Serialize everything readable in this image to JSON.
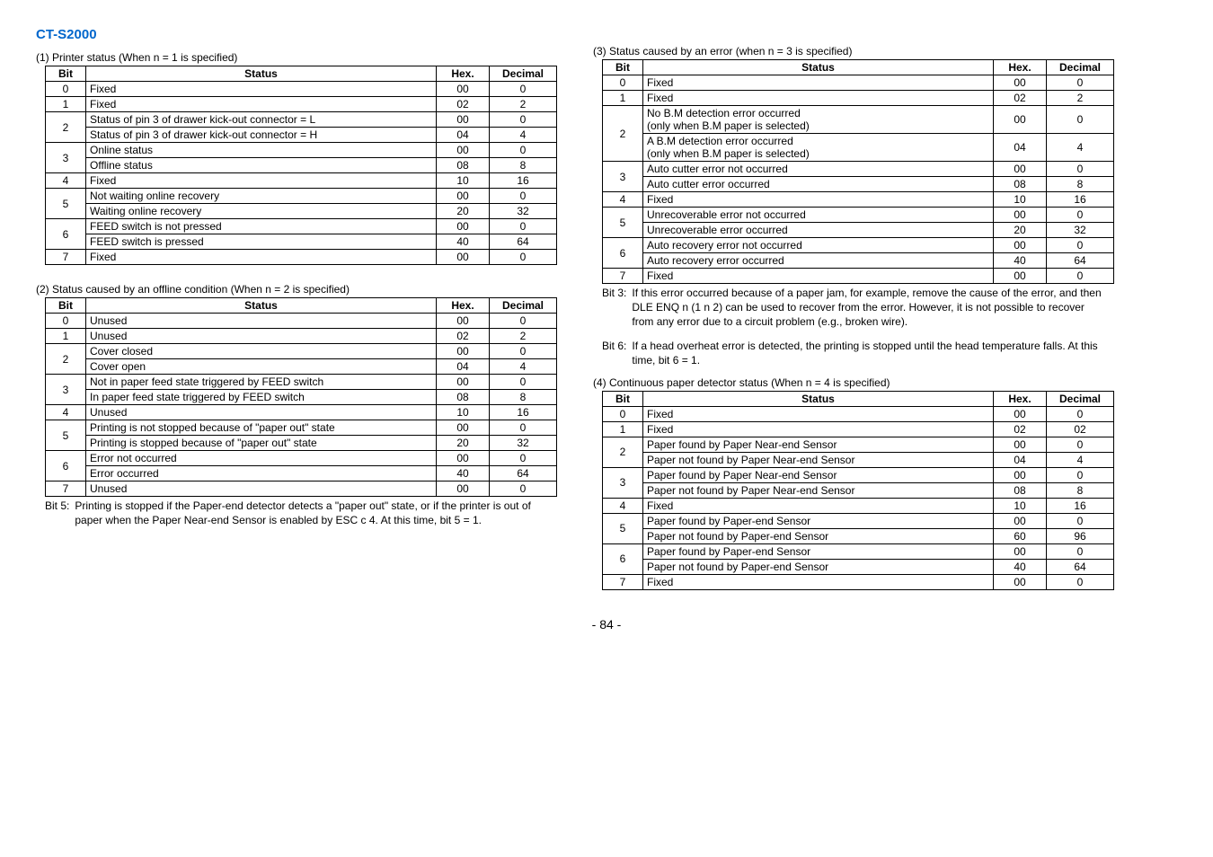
{
  "title": "CT-S2000",
  "page_number": "- 84 -",
  "left": {
    "caption1": "(1) Printer status (When n = 1 is specified)",
    "caption2": "(2) Status caused by an offline condition (When n = 2 is specified)",
    "note5_label": "Bit 5:",
    "note5_text": "Printing is stopped if the Paper-end detector detects a \"paper out\" state, or if the printer is out of paper when the Paper Near-end Sensor is enabled by ESC c 4. At this time, bit 5 = 1."
  },
  "right": {
    "caption3": "(3) Status caused by an error (when n = 3 is specified)",
    "caption4": "(4) Continuous paper detector status (When n = 4 is specified)",
    "note3_label": "Bit 3:",
    "note3_text": "If this error occurred because of a paper jam, for example, remove the cause of the error, and then DLE ENQ n (1 n 2) can be used to recover from the error. However, it is not possible to recover from any error due to a circuit problem (e.g., broken wire).",
    "note6_label": "Bit 6:",
    "note6_text": "If a head overheat error is detected, the printing is stopped until the head temperature falls. At this time, bit 6 = 1."
  },
  "headers": {
    "bit": "Bit",
    "status": "Status",
    "hex": "Hex.",
    "dec": "Decimal"
  },
  "chart_data": [
    {
      "type": "table",
      "id": "t1",
      "rows": [
        {
          "bit": "0",
          "rs": 1,
          "status": "Fixed",
          "hex": "00",
          "dec": "0"
        },
        {
          "bit": "1",
          "rs": 1,
          "status": "Fixed",
          "hex": "02",
          "dec": "2"
        },
        {
          "bit": "2",
          "rs": 2,
          "status": "Status of pin 3 of drawer kick-out connector = L",
          "hex": "00",
          "dec": "0"
        },
        {
          "status": "Status of pin 3 of drawer kick-out connector = H",
          "hex": "04",
          "dec": "4"
        },
        {
          "bit": "3",
          "rs": 2,
          "status": "Online status",
          "hex": "00",
          "dec": "0"
        },
        {
          "status": "Offline status",
          "hex": "08",
          "dec": "8"
        },
        {
          "bit": "4",
          "rs": 1,
          "status": "Fixed",
          "hex": "10",
          "dec": "16"
        },
        {
          "bit": "5",
          "rs": 2,
          "status": "Not waiting online recovery",
          "hex": "00",
          "dec": "0"
        },
        {
          "status": "Waiting online recovery",
          "hex": "20",
          "dec": "32"
        },
        {
          "bit": "6",
          "rs": 2,
          "status": "FEED switch is not pressed",
          "hex": "00",
          "dec": "0"
        },
        {
          "status": "FEED switch is pressed",
          "hex": "40",
          "dec": "64"
        },
        {
          "bit": "7",
          "rs": 1,
          "status": "Fixed",
          "hex": "00",
          "dec": "0"
        }
      ]
    },
    {
      "type": "table",
      "id": "t2",
      "rows": [
        {
          "bit": "0",
          "rs": 1,
          "status": "Unused",
          "hex": "00",
          "dec": "0"
        },
        {
          "bit": "1",
          "rs": 1,
          "status": "Unused",
          "hex": "02",
          "dec": "2"
        },
        {
          "bit": "2",
          "rs": 2,
          "status": "Cover closed",
          "hex": "00",
          "dec": "0"
        },
        {
          "status": "Cover open",
          "hex": "04",
          "dec": "4"
        },
        {
          "bit": "3",
          "rs": 2,
          "status": "Not in paper feed state triggered by FEED switch",
          "justify": true,
          "hex": "00",
          "dec": "0"
        },
        {
          "status": "In paper feed state triggered by FEED switch",
          "hex": "08",
          "dec": "8"
        },
        {
          "bit": "4",
          "rs": 1,
          "status": "Unused",
          "hex": "10",
          "dec": "16"
        },
        {
          "bit": "5",
          "rs": 2,
          "status": "Printing is not stopped because of \"paper out\" state",
          "hex": "00",
          "dec": "0"
        },
        {
          "status": "Printing is stopped because of \"paper out\" state",
          "hex": "20",
          "dec": "32"
        },
        {
          "bit": "6",
          "rs": 2,
          "status": "Error not occurred",
          "hex": "00",
          "dec": "0"
        },
        {
          "status": "Error occurred",
          "hex": "40",
          "dec": "64"
        },
        {
          "bit": "7",
          "rs": 1,
          "status": "Unused",
          "hex": "00",
          "dec": "0"
        }
      ]
    },
    {
      "type": "table",
      "id": "t3",
      "rows": [
        {
          "bit": "0",
          "rs": 1,
          "status": "Fixed",
          "hex": "00",
          "dec": "0"
        },
        {
          "bit": "1",
          "rs": 1,
          "status": "Fixed",
          "hex": "02",
          "dec": "2"
        },
        {
          "bit": "2",
          "rs": 2,
          "status": "No B.M detection error occurred\n(only when B.M paper is selected)",
          "hex": "00",
          "dec": "0"
        },
        {
          "status": "A B.M detection error occurred\n(only when B.M paper is selected)",
          "hex": "04",
          "dec": "4"
        },
        {
          "bit": "3",
          "rs": 2,
          "status": "Auto cutter error not occurred",
          "hex": "00",
          "dec": "0"
        },
        {
          "status": "Auto cutter error occurred",
          "hex": "08",
          "dec": "8"
        },
        {
          "bit": "4",
          "rs": 1,
          "status": "Fixed",
          "hex": "10",
          "dec": "16"
        },
        {
          "bit": "5",
          "rs": 2,
          "status": "Unrecoverable error not occurred",
          "hex": "00",
          "dec": "0"
        },
        {
          "status": "Unrecoverable error occurred",
          "hex": "20",
          "dec": "32"
        },
        {
          "bit": "6",
          "rs": 2,
          "status": "Auto recovery error not occurred",
          "hex": "00",
          "dec": "0"
        },
        {
          "status": "Auto recovery error occurred",
          "hex": "40",
          "dec": "64"
        },
        {
          "bit": "7",
          "rs": 1,
          "status": "Fixed",
          "hex": "00",
          "dec": "0"
        }
      ]
    },
    {
      "type": "table",
      "id": "t4",
      "rows": [
        {
          "bit": "0",
          "rs": 1,
          "status": "Fixed",
          "hex": "00",
          "dec": "0"
        },
        {
          "bit": "1",
          "rs": 1,
          "status": "Fixed",
          "hex": "02",
          "dec": "02"
        },
        {
          "bit": "2",
          "rs": 2,
          "status": "Paper found by Paper Near-end Sensor",
          "hex": "00",
          "dec": "0"
        },
        {
          "status": "Paper not found by Paper Near-end Sensor",
          "hex": "04",
          "dec": "4"
        },
        {
          "bit": "3",
          "rs": 2,
          "status": "Paper found by Paper Near-end Sensor",
          "hex": "00",
          "dec": "0"
        },
        {
          "status": "Paper not found by Paper Near-end Sensor",
          "hex": "08",
          "dec": "8"
        },
        {
          "bit": "4",
          "rs": 1,
          "status": "Fixed",
          "hex": "10",
          "dec": "16"
        },
        {
          "bit": "5",
          "rs": 2,
          "status": "Paper found by Paper-end Sensor",
          "hex": "00",
          "dec": "0"
        },
        {
          "status": "Paper not found by Paper-end Sensor",
          "hex": "60",
          "dec": "96"
        },
        {
          "bit": "6",
          "rs": 2,
          "status": "Paper found by Paper-end Sensor",
          "hex": "00",
          "dec": "0"
        },
        {
          "status": "Paper not found by Paper-end Sensor",
          "hex": "40",
          "dec": "64"
        },
        {
          "bit": "7",
          "rs": 1,
          "status": "Fixed",
          "hex": "00",
          "dec": "0"
        }
      ]
    }
  ]
}
